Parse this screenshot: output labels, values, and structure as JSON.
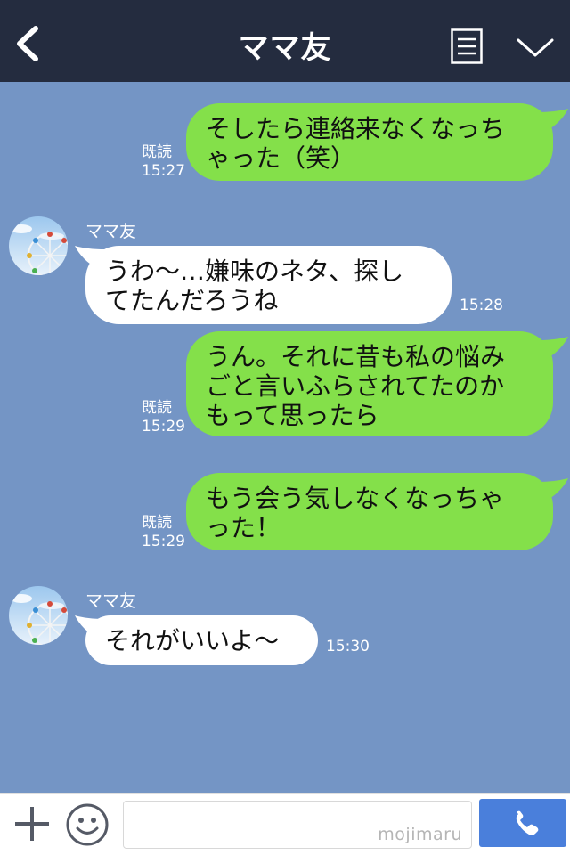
{
  "header": {
    "title": "ママ友"
  },
  "messages": [
    {
      "side": "out",
      "lines": [
        "そしたら連絡来なくなっち",
        "ゃった（笑）"
      ],
      "read": "既読",
      "time": "15:27"
    },
    {
      "side": "in",
      "sender": "ママ友",
      "lines": [
        "うわ〜…嫌味のネタ、探し",
        "てたんだろうね"
      ],
      "time": "15:28"
    },
    {
      "side": "out",
      "lines": [
        "うん。それに昔も私の悩み",
        "ごと言いふらされてたのか",
        "もって思ったら"
      ],
      "read": "既読",
      "time": "15:29"
    },
    {
      "side": "out",
      "lines": [
        "もう会う気しなくなっちゃ",
        "った！"
      ],
      "read": "既読",
      "time": "15:29"
    },
    {
      "side": "in",
      "sender": "ママ友",
      "lines": [
        "それがいいよ〜"
      ],
      "time": "15:30"
    }
  ],
  "footer": {
    "input_value": "",
    "watermark": "mojimaru"
  },
  "colors": {
    "background": "#7495c5",
    "header": "#242c3f",
    "outgoing_bubble": "#84e04a",
    "incoming_bubble": "#ffffff",
    "call_button": "#4a7fdb"
  },
  "icons": {
    "back": "chevron-left-icon",
    "menu": "menu-lines-icon",
    "collapse": "chevron-down-icon",
    "add": "plus-icon",
    "emoji": "smiley-icon",
    "call": "phone-icon"
  }
}
